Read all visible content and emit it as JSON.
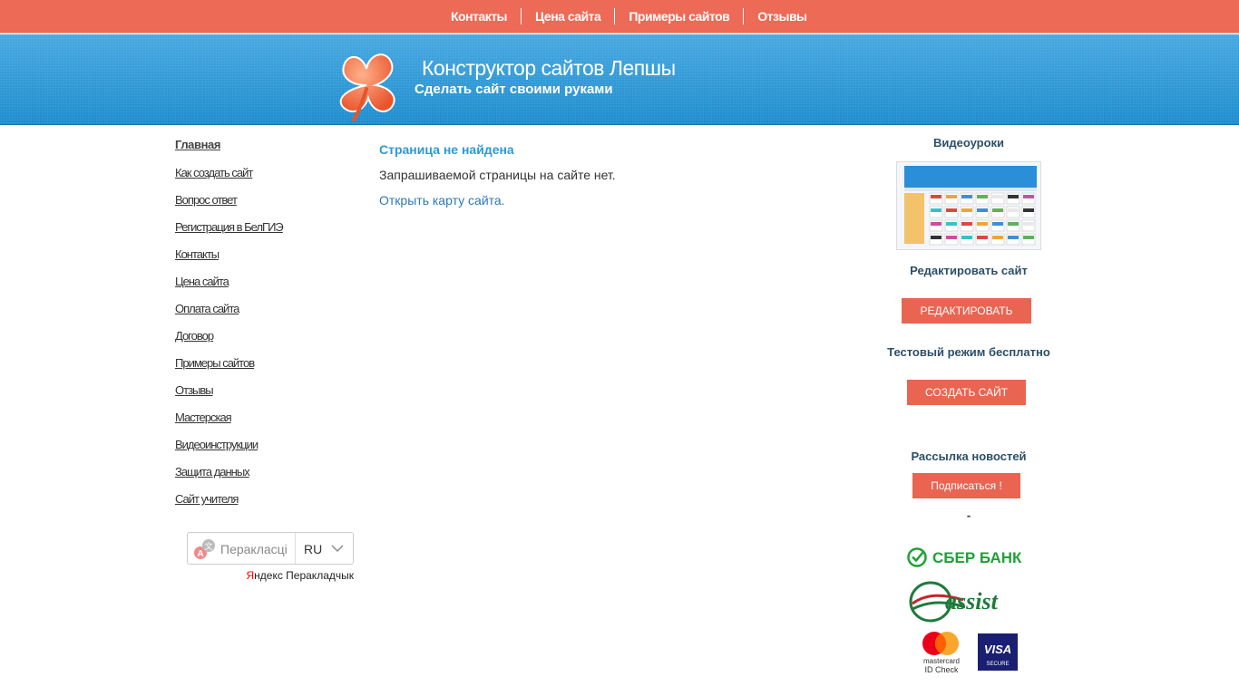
{
  "topnav": {
    "items": [
      "Контакты",
      "Цена сайта",
      "Примеры сайтов",
      "Отзывы"
    ]
  },
  "header": {
    "title": "Конструктор сайтов Лепшы",
    "subtitle": "Сделать сайт своими руками"
  },
  "leftmenu": {
    "home": "Главная",
    "items": [
      "Как создать сайт",
      "Вопрос ответ",
      "Регистрация в БелГИЭ",
      "Контакты",
      "Цена сайта",
      "Оплата сайта",
      "Договор",
      "Примеры сайтов",
      "Отзывы",
      "Мастерская",
      "Видеоинструкции",
      "Защита данных",
      "Сайт учителя"
    ]
  },
  "translator": {
    "label": "Перакласці",
    "lang": "RU",
    "credit_ya": "Я",
    "credit_rest": "ндекс Перакладчык"
  },
  "content": {
    "heading": "Страница не найдена",
    "message": "Запрашиваемой страницы на сайте нет.",
    "sitemap_link": "Открыть карту сайта."
  },
  "sidebar_right": {
    "video_title": "Видеоуроки",
    "edit_title": "Редактировать сайт",
    "edit_button": "РЕДАКТИРОВАТЬ",
    "test_title": "Тестовый режим бесплатно",
    "create_button": "СОЗДАТЬ САЙТ",
    "news_title": "Рассылка новостей",
    "subscribe_button": "Подписаться !",
    "dash": "-",
    "sber_text": "СБЕР БАНК",
    "assist_text": "assist",
    "mc_text1": "mastercard",
    "mc_text2": "ID Check",
    "visa_text": "VISA",
    "visa_sub": "SECURE"
  },
  "colors": {
    "nav_bg": "#ec6a56",
    "header_blue": "#1d8ccd",
    "accent_button": "#ea6452",
    "link_blue": "#2b9ad6",
    "sber_green": "#21a038"
  }
}
